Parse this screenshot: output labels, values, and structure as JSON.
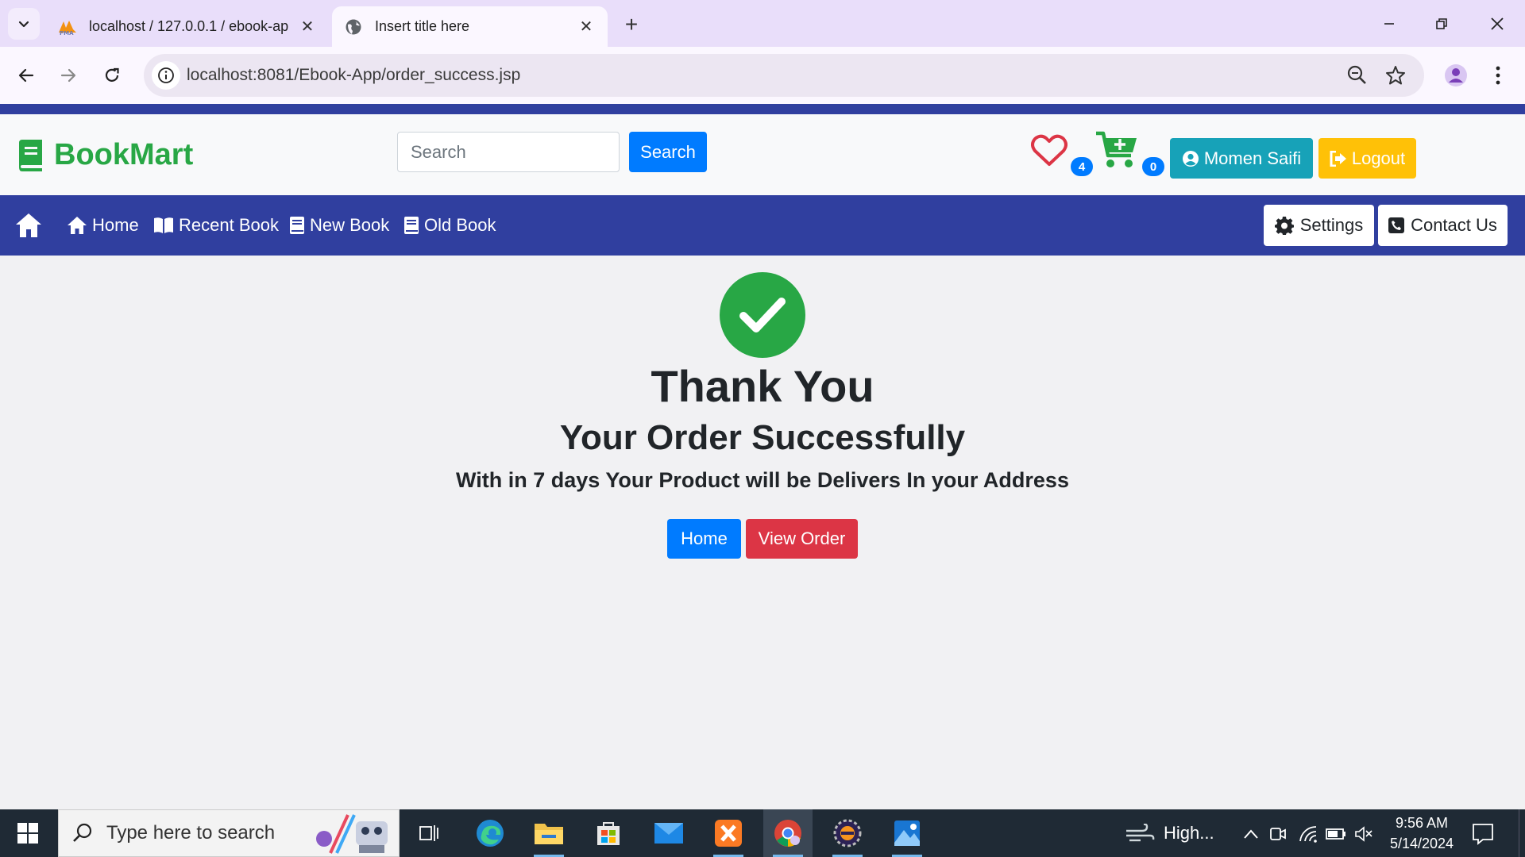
{
  "browser": {
    "tabs": [
      {
        "title": "localhost / 127.0.0.1 / ebook-ap",
        "favicon": "phpmyadmin-icon",
        "active": false
      },
      {
        "title": "Insert title here",
        "favicon": "globe-icon",
        "active": true
      }
    ],
    "url": "localhost:8081/Ebook-App/order_success.jsp"
  },
  "header": {
    "brand": "BookMart",
    "search_placeholder": "Search",
    "search_button": "Search",
    "wishlist_count": "4",
    "cart_count": "0",
    "user_button": "Momen Saifi",
    "logout_button": "Logout"
  },
  "navbar": {
    "items": [
      {
        "label": "Home",
        "icon": "home-icon"
      },
      {
        "label": "Recent Book",
        "icon": "book-open-icon"
      },
      {
        "label": "New Book",
        "icon": "book-icon"
      },
      {
        "label": "Old Book",
        "icon": "book-icon"
      }
    ],
    "settings": "Settings",
    "contact": "Contact Us"
  },
  "main": {
    "thank_you": "Thank You",
    "order_message": "Your Order Successfully",
    "delivery_message": "With in 7 days Your Product will be Delivers In your Address",
    "home_button": "Home",
    "view_order_button": "View Order"
  },
  "taskbar": {
    "search_placeholder": "Type here to search",
    "weather": "High...",
    "time": "9:56 AM",
    "date": "5/14/2024"
  },
  "colors": {
    "brand_green": "#28a745",
    "navbar_blue": "#303f9f",
    "primary": "#007bff",
    "danger": "#dc3545",
    "info": "#17a2b8",
    "warning": "#ffc107"
  }
}
